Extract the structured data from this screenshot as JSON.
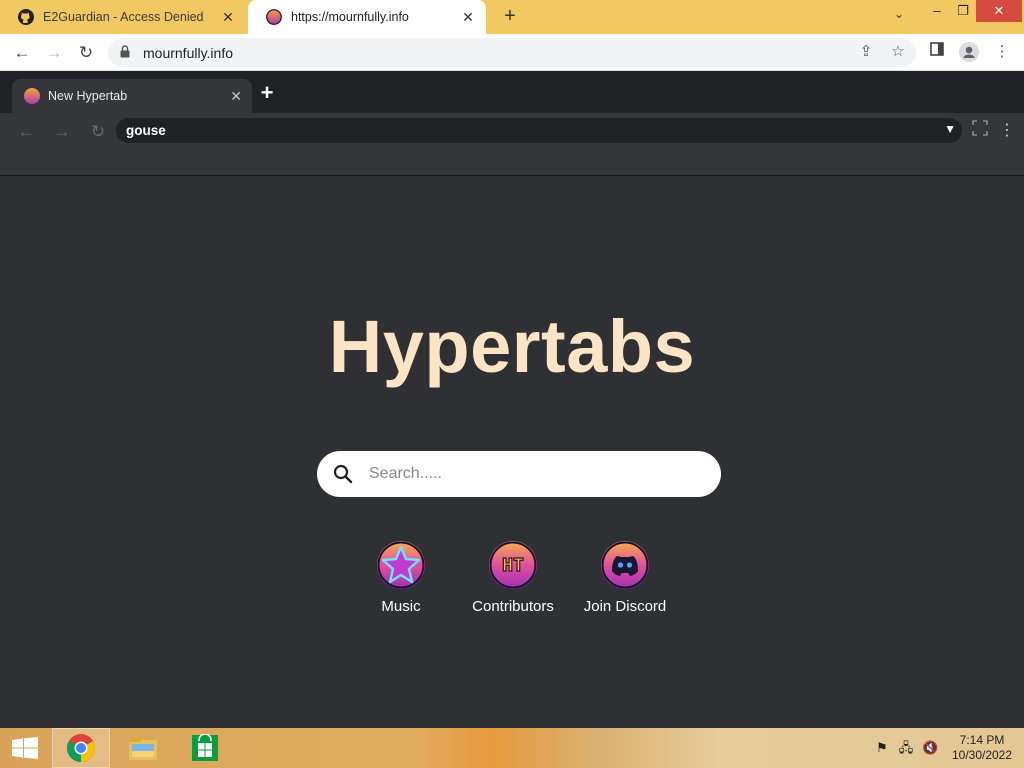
{
  "browser": {
    "tabs": [
      {
        "label": "E2Guardian - Access Denied",
        "icon": "github-icon"
      },
      {
        "label": "https://mournfully.info",
        "icon": "hypertabs-favicon"
      }
    ],
    "address": "mournfully.info"
  },
  "hypertabs": {
    "tab_label": "New Hypertab",
    "address_value": "gouse",
    "brand": "Hypertabs",
    "search_placeholder": "Search.....",
    "shortcuts": [
      {
        "label": "Music",
        "icon": "star-icon"
      },
      {
        "label": "Contributors",
        "icon": "ht-logo-icon"
      },
      {
        "label": "Join Discord",
        "icon": "discord-icon"
      }
    ]
  },
  "taskbar": {
    "time": "7:14 PM",
    "date": "10/30/2022"
  },
  "colors": {
    "brand": "#fde4c4",
    "background": "#2e3033",
    "chrome_frame": "#f2c863"
  }
}
